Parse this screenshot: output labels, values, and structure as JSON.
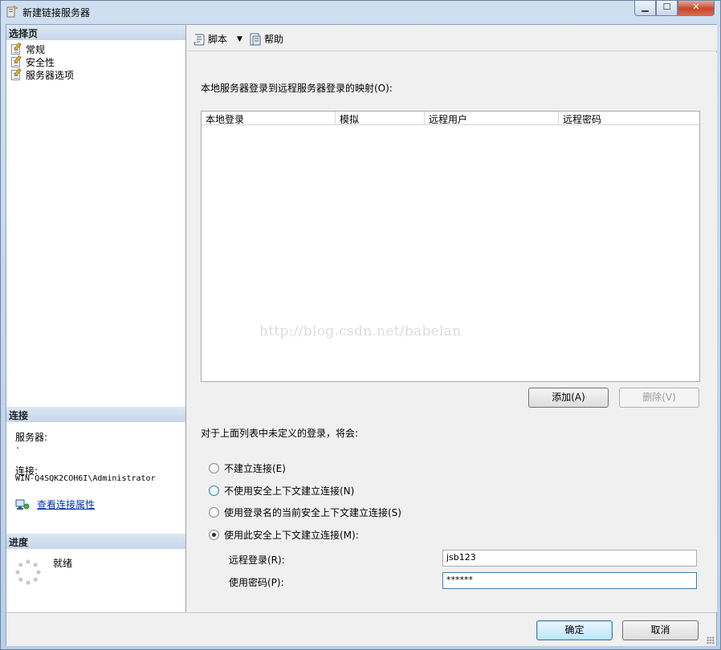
{
  "window": {
    "title": "新建链接服务器"
  },
  "left_pane": {
    "select_page_header": "选择页",
    "pages": [
      {
        "label": "常规"
      },
      {
        "label": "安全性"
      },
      {
        "label": "服务器选项"
      }
    ],
    "connection": {
      "header": "连接",
      "server_label": "服务器:",
      "server_value": ".",
      "connection_label": "连接:",
      "connection_value": "WIN-Q4SQK2COH6I\\Administrator",
      "view_link": "查看连接属性"
    },
    "progress": {
      "header": "进度",
      "status": "就绪"
    }
  },
  "toolbar": {
    "script_label": "脚本",
    "help_label": "帮助"
  },
  "security": {
    "mapping_label": "本地服务器登录到远程服务器登录的映射(O):",
    "columns": [
      "本地登录",
      "模拟",
      "远程用户",
      "远程密码"
    ],
    "rows": [],
    "add_button": "添加(A)",
    "delete_button": "删除(V)",
    "undefined_label": "对于上面列表中未定义的登录，将会:",
    "options": [
      {
        "label": "不建立连接(E)",
        "checked": false
      },
      {
        "label": "不使用安全上下文建立连接(N)",
        "checked": false
      },
      {
        "label": "使用登录名的当前安全上下文建立连接(S)",
        "checked": false
      },
      {
        "label": "使用此安全上下文建立连接(M):",
        "checked": true
      }
    ],
    "remote_login_label": "远程登录(R):",
    "remote_login_value": "jsb123",
    "password_label": "使用密码(P):",
    "password_value": "******"
  },
  "watermark": "http://blog.csdn.net/babelan",
  "footer": {
    "ok_button": "确定",
    "cancel_button": "取消"
  },
  "icons": {
    "window": "linked-server-icon",
    "page": "page-icon",
    "script": "script-icon",
    "help": "help-icon",
    "connection": "connection-properties-icon",
    "progress": "progress-spinner-icon"
  }
}
